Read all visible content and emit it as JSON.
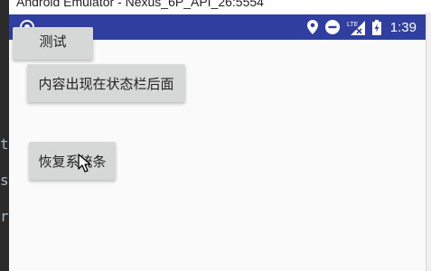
{
  "window": {
    "title": "Android Emulator - Nexus_6P_API_26:5554"
  },
  "editor_background": {
    "glyphs": [
      "t",
      "s",
      "r"
    ]
  },
  "status_bar": {
    "color": "#303f9f",
    "left_icon": "notification-ring-icon",
    "icons": [
      "location-icon",
      "do-not-disturb-icon",
      "lte-signal-icon",
      "battery-charging-icon"
    ],
    "network_label": "LTE",
    "time": "1:39"
  },
  "buttons": {
    "test_label": "测试",
    "status_bar_behind_label": "内容出现在状态栏后面",
    "restore_system_bar_label": "恢复系统条"
  }
}
